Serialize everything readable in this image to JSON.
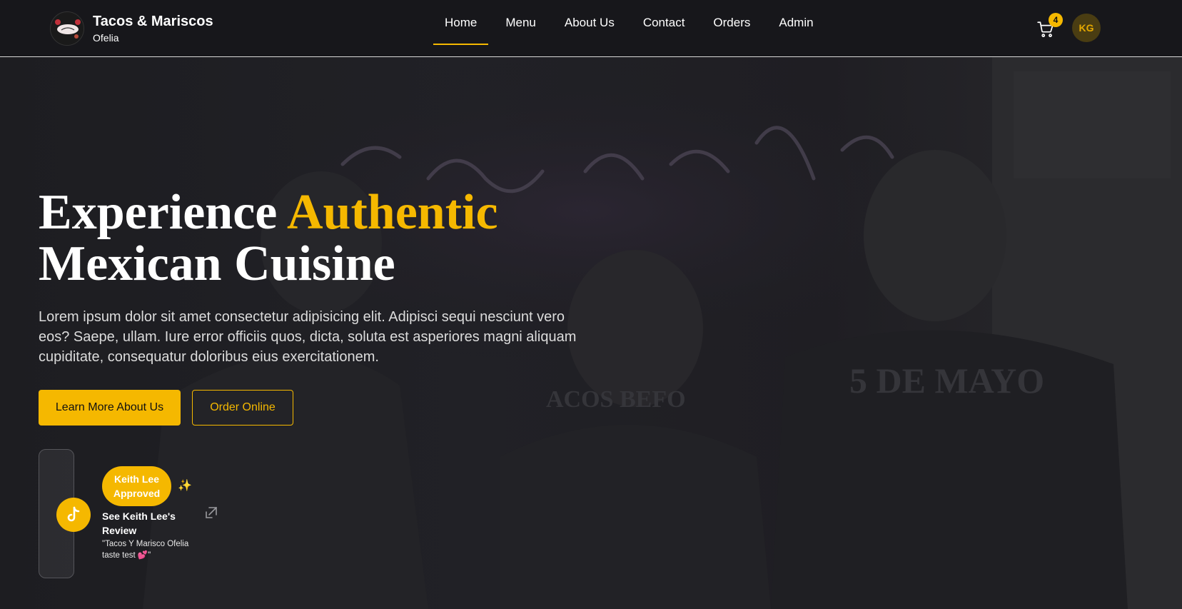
{
  "brand": {
    "title": "Tacos & Mariscos",
    "subtitle": "Ofelia",
    "logo_icon": "restaurant-logo"
  },
  "nav": {
    "items": [
      {
        "label": "Home",
        "active": true
      },
      {
        "label": "Menu",
        "active": false
      },
      {
        "label": "About Us",
        "active": false
      },
      {
        "label": "Contact",
        "active": false
      },
      {
        "label": "Orders",
        "active": false
      },
      {
        "label": "Admin",
        "active": false
      }
    ]
  },
  "cart": {
    "icon": "cart-icon",
    "count": "4"
  },
  "user": {
    "initials": "KG"
  },
  "hero": {
    "title_part1": "Experience ",
    "title_accent": "Authentic",
    "title_part2": "Mexican Cuisine",
    "description": "Lorem ipsum dolor sit amet consectetur adipisicing elit. Adipisci sequi nesciunt vero eos? Saepe, ullam. Iure error officiis quos, dicta, soluta est asperiores magni aliquam cupiditate, consequatur doloribus eius exercitationem.",
    "primary_button": "Learn More About Us",
    "secondary_button": "Order Online"
  },
  "review": {
    "badge": "Keith Lee Approved",
    "title": "See Keith Lee's Review",
    "quote": "\"Tacos Y Marisco Ofelia taste test 💕\"",
    "icon": "tiktok-icon",
    "link_icon": "external-link-icon"
  },
  "colors": {
    "accent": "#f5b800",
    "nav_bg": "#17171b",
    "hero_overlay": "#1d1d21"
  }
}
